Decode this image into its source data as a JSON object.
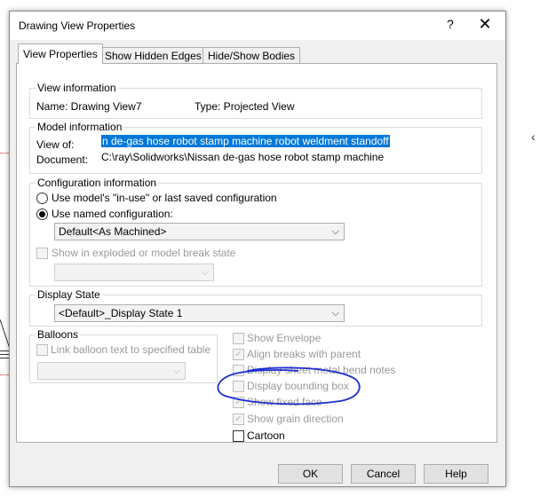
{
  "window": {
    "title": "Drawing View Properties",
    "help_glyph": "?",
    "close_glyph": "✕"
  },
  "tabs": [
    {
      "label": "View Properties",
      "active": true
    },
    {
      "label": "Show Hidden Edges",
      "active": false
    },
    {
      "label": "Hide/Show Bodies",
      "active": false
    }
  ],
  "view_information": {
    "title": "View information",
    "name_text": "Name: Drawing View7",
    "type_text": "Type: Projected View"
  },
  "model_information": {
    "title": "Model information",
    "view_of_label": "View of:",
    "view_of_value": "n de-gas hose robot stamp machine robot weldment standoff",
    "document_label": "Document:",
    "document_value": "C:\\ray\\Solidworks\\Nissan de-gas hose robot stamp machine"
  },
  "configuration": {
    "title": "Configuration information",
    "option_in_use": "Use model's \"in-use\" or last saved configuration",
    "option_named": "Use named configuration:",
    "named_selected": true,
    "config_value": "Default<As Machined>",
    "exploded_label": "Show in exploded or model break state",
    "exploded_value": ""
  },
  "display_state": {
    "title": "Display State",
    "value": "<Default>_Display State 1"
  },
  "balloons": {
    "title": "Balloons",
    "link_label": "Link balloon text to specified table",
    "table_value": ""
  },
  "options": [
    {
      "label": "Show Envelope",
      "checked": false,
      "enabled": false
    },
    {
      "label": "Align breaks with parent",
      "checked": true,
      "enabled": false
    },
    {
      "label": "Display sheet metal bend notes",
      "checked": false,
      "enabled": false
    },
    {
      "label": "Display bounding box",
      "checked": false,
      "enabled": false
    },
    {
      "label": "Show fixed face",
      "checked": true,
      "enabled": false
    },
    {
      "label": "Show grain direction",
      "checked": true,
      "enabled": false
    },
    {
      "label": "Cartoon",
      "checked": false,
      "enabled": true
    }
  ],
  "buttons": {
    "ok": "OK",
    "cancel": "Cancel",
    "help": "Help"
  },
  "colors": {
    "selection": "#0078d7",
    "annotation": "#1a2ecf",
    "dialog_bg": "#f0f0f0"
  },
  "glyphs": {
    "dropdown": "⌵",
    "checkmark": "✓"
  }
}
